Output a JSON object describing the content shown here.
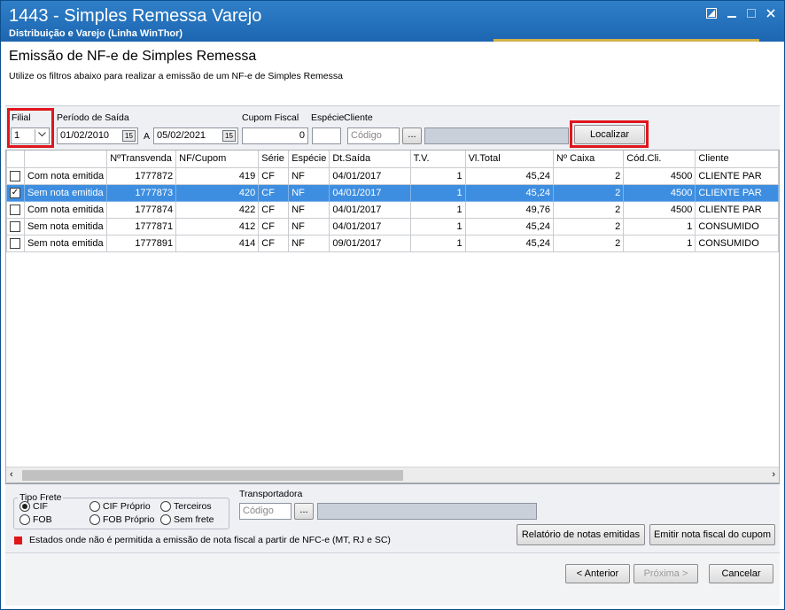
{
  "window": {
    "title": "1443 - Simples Remessa Varejo",
    "subtitle": "Distribuição e Varejo (Linha WinThor)"
  },
  "header": {
    "title": "Emissão de NF-e de Simples Remessa",
    "description": "Utilize os filtros abaixo para realizar a emissão de um NF-e de Simples Remessa"
  },
  "filters": {
    "filial_label": "Filial",
    "filial_value": "1",
    "periodo_label": "Período de Saída",
    "date_from": "01/02/2010",
    "a_label": "A",
    "date_to": "05/02/2021",
    "cupom_label": "Cupom Fiscal",
    "cupom_value": "0",
    "especie_label": "Espécie",
    "especie_value": "",
    "cliente_label": "Cliente",
    "cliente_placeholder": "Código",
    "browse_label": "...",
    "localizar_label": "Localizar"
  },
  "table": {
    "columns": [
      "",
      "",
      "NºTransvenda",
      "NF/Cupom",
      "Série",
      "Espécie",
      "Dt.Saída",
      "T.V.",
      "Vl.Total",
      "Nº Caixa",
      "Cód.Cli.",
      "Cliente"
    ],
    "rows": [
      {
        "checked": false,
        "selected": false,
        "cells": [
          "Com nota emitida",
          "1777872",
          "419",
          "CF",
          "NF",
          "04/01/2017",
          "1",
          "45,24",
          "2",
          "4500",
          "CLIENTE PAR"
        ]
      },
      {
        "checked": true,
        "selected": true,
        "cells": [
          "Sem nota emitida",
          "1777873",
          "420",
          "CF",
          "NF",
          "04/01/2017",
          "1",
          "45,24",
          "2",
          "4500",
          "CLIENTE PAR"
        ]
      },
      {
        "checked": false,
        "selected": false,
        "cells": [
          "Com nota emitida",
          "1777874",
          "422",
          "CF",
          "NF",
          "04/01/2017",
          "1",
          "49,76",
          "2",
          "4500",
          "CLIENTE PAR"
        ]
      },
      {
        "checked": false,
        "selected": false,
        "cells": [
          "Sem nota emitida",
          "1777871",
          "412",
          "CF",
          "NF",
          "04/01/2017",
          "1",
          "45,24",
          "2",
          "1",
          "CONSUMIDO"
        ]
      },
      {
        "checked": false,
        "selected": false,
        "cells": [
          "Sem nota emitida",
          "1777891",
          "414",
          "CF",
          "NF",
          "09/01/2017",
          "1",
          "45,24",
          "2",
          "1",
          "CONSUMIDO"
        ]
      }
    ]
  },
  "frete": {
    "legend": "Tipo Frete",
    "options": [
      "CIF",
      "FOB",
      "CIF Próprio",
      "FOB Próprio",
      "Terceiros",
      "Sem frete"
    ],
    "selected": "CIF"
  },
  "transportadora": {
    "label": "Transportadora",
    "placeholder": "Código",
    "browse_label": "..."
  },
  "notice": {
    "text": "Estados onde não é permitida a emissão de nota fiscal a partir de NFC-e (MT, RJ e SC)",
    "color": "#e0161d"
  },
  "buttons": {
    "relatorio": "Relatório de notas emitidas",
    "emitir": "Emitir nota fiscal do cupom",
    "anterior": "< Anterior",
    "proxima": "Próxima >",
    "cancelar": "Cancelar"
  }
}
